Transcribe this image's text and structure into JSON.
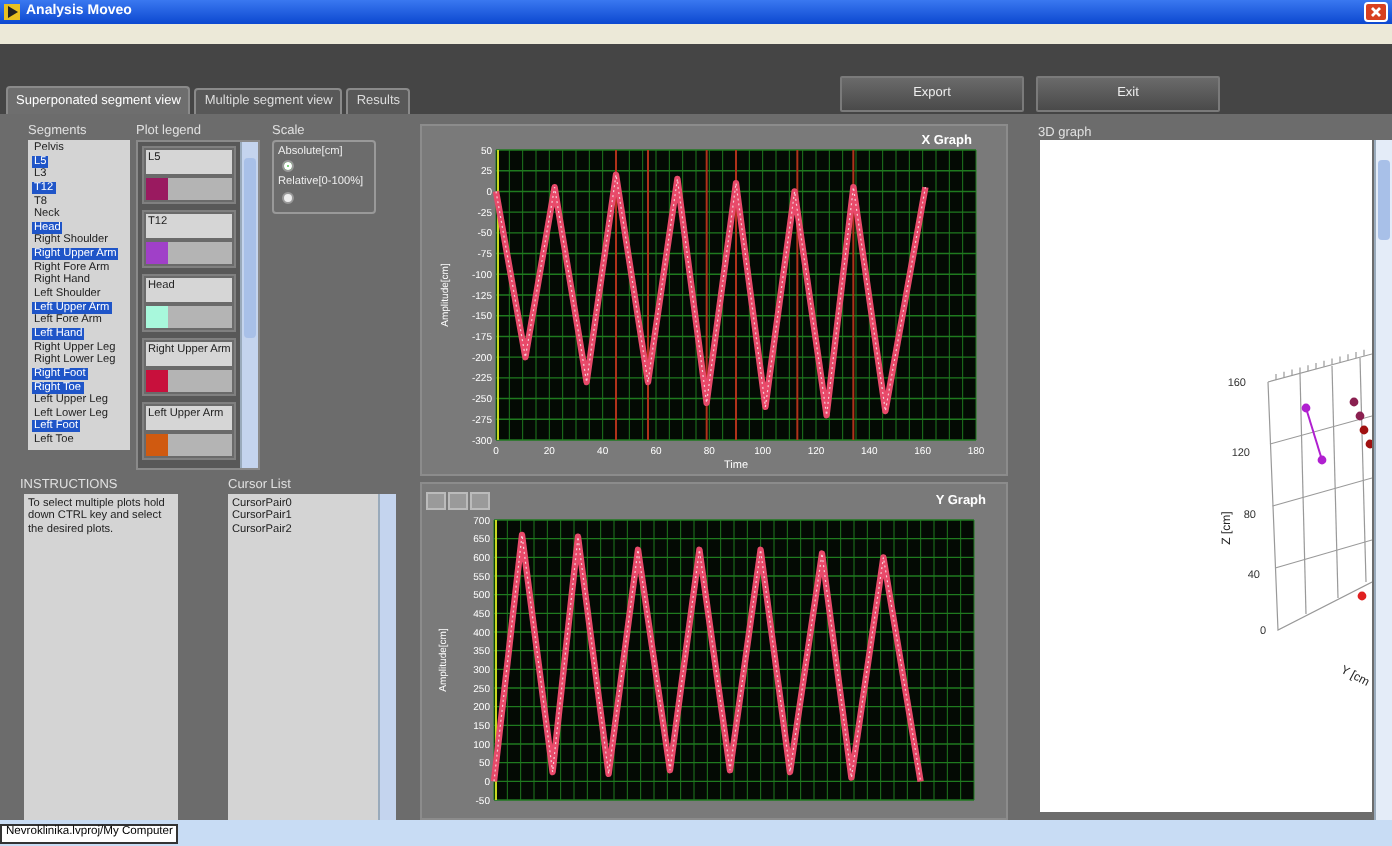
{
  "window": {
    "title": "Analysis Moveo"
  },
  "tabs": [
    {
      "label": "Superponated segment view",
      "selected": true
    },
    {
      "label": "Multiple segment view",
      "selected": false
    },
    {
      "label": "Results",
      "selected": false
    }
  ],
  "buttons": [
    "Export",
    "Exit"
  ],
  "segments": {
    "label": "Segments",
    "items": [
      {
        "label": "Pelvis",
        "selected": false
      },
      {
        "label": "L5",
        "selected": true
      },
      {
        "label": "L3",
        "selected": false
      },
      {
        "label": "T12",
        "selected": true
      },
      {
        "label": "T8",
        "selected": false
      },
      {
        "label": "Neck",
        "selected": false
      },
      {
        "label": "Head",
        "selected": true
      },
      {
        "label": "Right Shoulder",
        "selected": false
      },
      {
        "label": "Right Upper Arm",
        "selected": true
      },
      {
        "label": "Right Fore Arm",
        "selected": false
      },
      {
        "label": "Right Hand",
        "selected": false
      },
      {
        "label": "Left Shoulder",
        "selected": false
      },
      {
        "label": "Left Upper Arm",
        "selected": true
      },
      {
        "label": "Left Fore Arm",
        "selected": false
      },
      {
        "label": "Left Hand",
        "selected": true
      },
      {
        "label": "Right Upper Leg",
        "selected": false
      },
      {
        "label": "Right Lower Leg",
        "selected": false
      },
      {
        "label": "Right Foot",
        "selected": true
      },
      {
        "label": "Right Toe",
        "selected": true
      },
      {
        "label": "Left Upper Leg",
        "selected": false
      },
      {
        "label": "Left Lower Leg",
        "selected": false
      },
      {
        "label": "Left Foot",
        "selected": true
      },
      {
        "label": "Left Toe",
        "selected": false
      }
    ]
  },
  "plot_legend": {
    "label": "Plot legend",
    "items": [
      {
        "name": "L5",
        "color": "#9a1a60"
      },
      {
        "name": "T12",
        "color": "#a040c8"
      },
      {
        "name": "Head",
        "color": "#a8f8dc"
      },
      {
        "name": "Right Upper Arm",
        "color": "#c8103c"
      },
      {
        "name": "Left Upper Arm",
        "color": "#d05a10"
      }
    ]
  },
  "scale": {
    "label": "Scale",
    "options": [
      {
        "label": "Absolute[cm]",
        "selected": true
      },
      {
        "label": "Relative[0-100%]",
        "selected": false
      }
    ]
  },
  "instructions": {
    "label": "INSTRUCTIONS",
    "text": "To select multiple plots hold down CTRL key and select the desired plots."
  },
  "cursor_list": {
    "label": "Cursor List",
    "items": [
      "CursorPair0",
      "CursorPair1",
      "CursorPair2"
    ]
  },
  "x_graph": {
    "chart_data": {
      "type": "line",
      "title": "X Graph",
      "xlabel": "Time",
      "ylabel": "Amplitude[cm]",
      "x": [
        0,
        11,
        22,
        34,
        45,
        57,
        68,
        79,
        90,
        101,
        112,
        124,
        134,
        146,
        161
      ],
      "series": [
        {
          "color": "#e84a6a",
          "values": [
            0,
            -200,
            5,
            -230,
            20,
            -230,
            15,
            -255,
            10,
            -260,
            0,
            -270,
            5,
            -265,
            5
          ]
        }
      ],
      "xlim": [
        0,
        180
      ],
      "ylim": [
        -300,
        50
      ],
      "xticks": [
        0,
        20,
        40,
        60,
        80,
        100,
        120,
        140,
        160,
        180
      ],
      "yticks": [
        -300,
        -275,
        -250,
        -225,
        -200,
        -175,
        -150,
        -125,
        -100,
        -75,
        -50,
        -25,
        0,
        25,
        50
      ],
      "grid": true,
      "ref_lines": [
        {
          "axis": "x",
          "value": 45
        },
        {
          "axis": "x",
          "value": 57
        },
        {
          "axis": "x",
          "value": 79
        },
        {
          "axis": "x",
          "value": 90
        },
        {
          "axis": "x",
          "value": 113
        },
        {
          "axis": "x",
          "value": 134
        }
      ]
    }
  },
  "y_graph": {
    "chart_data": {
      "type": "line",
      "title": "Y Graph",
      "ylabel": "Amplitude[cm]",
      "x": [
        0,
        10.5,
        22,
        31.5,
        43,
        54,
        66,
        77,
        88.5,
        100,
        111,
        123,
        134,
        146,
        160
      ],
      "series": [
        {
          "color": "#e84a6a",
          "values": [
            0,
            660,
            25,
            655,
            20,
            620,
            30,
            620,
            30,
            620,
            25,
            610,
            10,
            600,
            0
          ]
        }
      ],
      "xlim": [
        0,
        180
      ],
      "ylim": [
        -50,
        700
      ],
      "grid": true,
      "yticks": [
        -50,
        0,
        50,
        100,
        150,
        200,
        250,
        300,
        350,
        400,
        450,
        500,
        550,
        600,
        650,
        700
      ]
    }
  },
  "graph_3d": {
    "label": "3D graph",
    "z_axis_label": "Z [cm]",
    "z_ticks": [
      "160",
      "120",
      "80",
      "40",
      "0"
    ],
    "y_axis_label": "Y [cm"
  },
  "status_bar": {
    "path": "Nevroklinika.lvproj/My Computer"
  }
}
